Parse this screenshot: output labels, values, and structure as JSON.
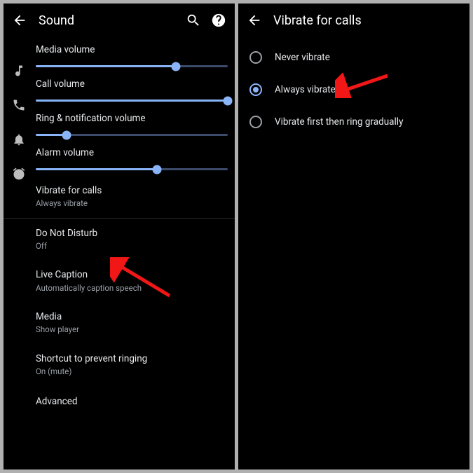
{
  "colors": {
    "accent": "#8ab4f8",
    "arrow": "#f11717",
    "secondary": "#9aa0a6"
  },
  "left": {
    "header": {
      "title": "Sound"
    },
    "sliders": [
      {
        "label": "Media volume",
        "value": 73,
        "icon": "music-note-icon"
      },
      {
        "label": "Call volume",
        "value": 100,
        "icon": "phone-icon"
      },
      {
        "label": "Ring & notification volume",
        "value": 16,
        "icon": "bell-icon"
      },
      {
        "label": "Alarm volume",
        "value": 63,
        "icon": "alarm-icon"
      }
    ],
    "items": [
      {
        "primary": "Vibrate for calls",
        "secondary": "Always vibrate"
      },
      {
        "primary": "Do Not Disturb",
        "secondary": "Off"
      },
      {
        "primary": "Live Caption",
        "secondary": "Automatically caption speech"
      },
      {
        "primary": "Media",
        "secondary": "Show player"
      },
      {
        "primary": "Shortcut to prevent ringing",
        "secondary": "On (mute)"
      }
    ],
    "advanced": "Advanced"
  },
  "right": {
    "header": {
      "title": "Vibrate for calls"
    },
    "options": [
      {
        "label": "Never vibrate",
        "selected": false
      },
      {
        "label": "Always vibrate",
        "selected": true
      },
      {
        "label": "Vibrate first then ring gradually",
        "selected": false
      }
    ]
  }
}
